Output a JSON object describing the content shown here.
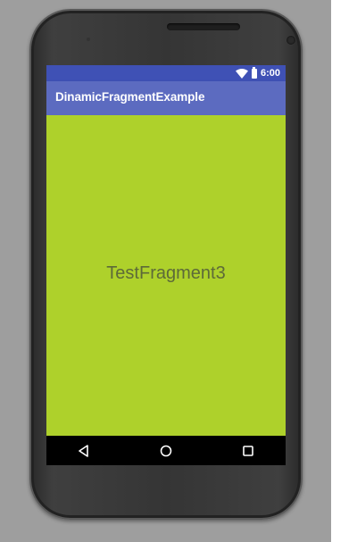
{
  "status_bar": {
    "time": "6:00",
    "icons": [
      "wifi-icon",
      "battery-icon"
    ],
    "color": "#3f51b5"
  },
  "app_bar": {
    "title": "DinamicFragmentExample",
    "color": "#5c6bc0"
  },
  "content": {
    "fragment_label": "TestFragment3",
    "background_color": "#aed12b",
    "text_color": "#5d6a38"
  },
  "nav_bar": {
    "buttons": [
      "back-icon",
      "home-icon",
      "recents-icon"
    ]
  }
}
